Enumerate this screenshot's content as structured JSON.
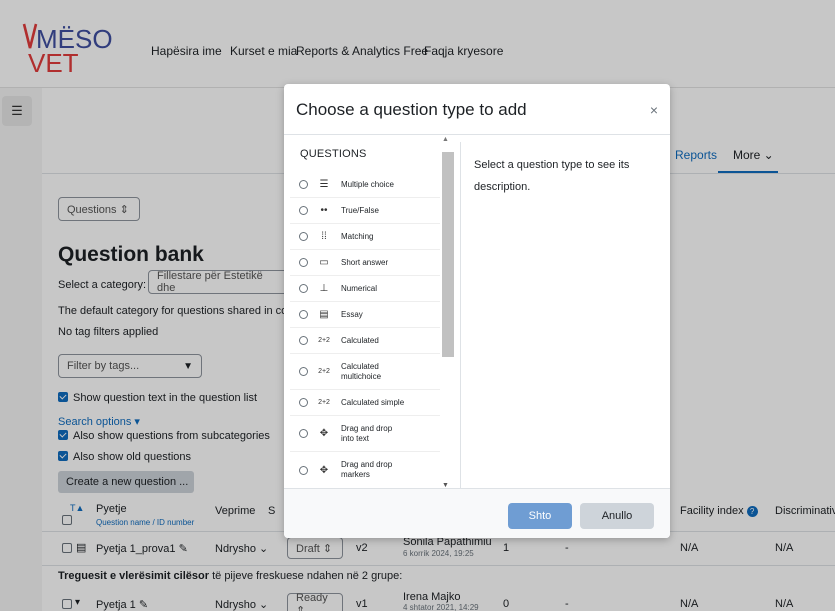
{
  "nav": {
    "logo_top": "MËSO",
    "logo_bottom": "VET",
    "links": [
      "Hapësira ime",
      "Kurset e mia",
      "Reports & Analytics Free",
      "Faqja kryesore"
    ]
  },
  "tabs": {
    "reports": "Reports",
    "more": "More ⌄"
  },
  "page": {
    "questions_select": "Questions  ⇕",
    "title": "Question bank",
    "select_category_label": "Select a category:",
    "category_value": "Fillestare për Estetikë dhe",
    "default_category_text": "The default category for questions shared in co",
    "no_tag_filters": "No tag filters applied",
    "filter_by_tags": "Filter by tags...",
    "show_question_text": "Show question text in the question list",
    "search_options": "Search options ▾",
    "also_subcategories": "Also show questions from subcategories",
    "also_old": "Also show old questions",
    "create_new": "Create a new question ..."
  },
  "table": {
    "col_t": "T",
    "col_question": "Pyetje",
    "col_question_sub": "Question name / ID number",
    "col_actions": "Veprime",
    "col_s": "S",
    "col_facility": "Facility index",
    "col_discrimination": "Discriminativ",
    "rows": [
      {
        "name": "Pyetja 1_prova1",
        "action": "Ndrysho ⌄",
        "status": "Draft  ⇕",
        "version": "v2",
        "author": "Sonila Papathimiu",
        "date": "6 korrik 2024, 19:25",
        "usage": "1",
        "last_used": "-",
        "facility": "N/A",
        "disc": "N/A"
      },
      {
        "name": "Pyetja 1",
        "action": "Ndrysho ⌄",
        "status": "Ready  ⇕",
        "version": "v1",
        "author": "Irena Majko",
        "date": "4 shtator 2021, 14:29",
        "usage": "0",
        "last_used": "-",
        "facility": "N/A",
        "disc": "N/A"
      }
    ],
    "group_note_bold": "Treguesit e vlerësimit cilësor",
    "group_note_rest": " të pijeve freskuese ndahen në 2 grupe:"
  },
  "modal": {
    "title": "Choose a question type to add",
    "close": "×",
    "list_heading": "QUESTIONS",
    "description": "Select a question type to see its description.",
    "types": [
      {
        "label": "Multiple choice",
        "icon": "☰"
      },
      {
        "label": "True/False",
        "icon": "••"
      },
      {
        "label": "Matching",
        "icon": "⁞⁞"
      },
      {
        "label": "Short answer",
        "icon": "▭"
      },
      {
        "label": "Numerical",
        "icon": "⊥"
      },
      {
        "label": "Essay",
        "icon": "▤"
      },
      {
        "label": "Calculated",
        "icon": "2+2"
      },
      {
        "label": "Calculated multichoice",
        "icon": "2+2"
      },
      {
        "label": "Calculated simple",
        "icon": "2+2"
      },
      {
        "label": "Drag and drop into text",
        "icon": "✥"
      },
      {
        "label": "Drag and drop markers",
        "icon": "✥"
      }
    ],
    "add_button": "Shto",
    "cancel_button": "Anullo"
  }
}
